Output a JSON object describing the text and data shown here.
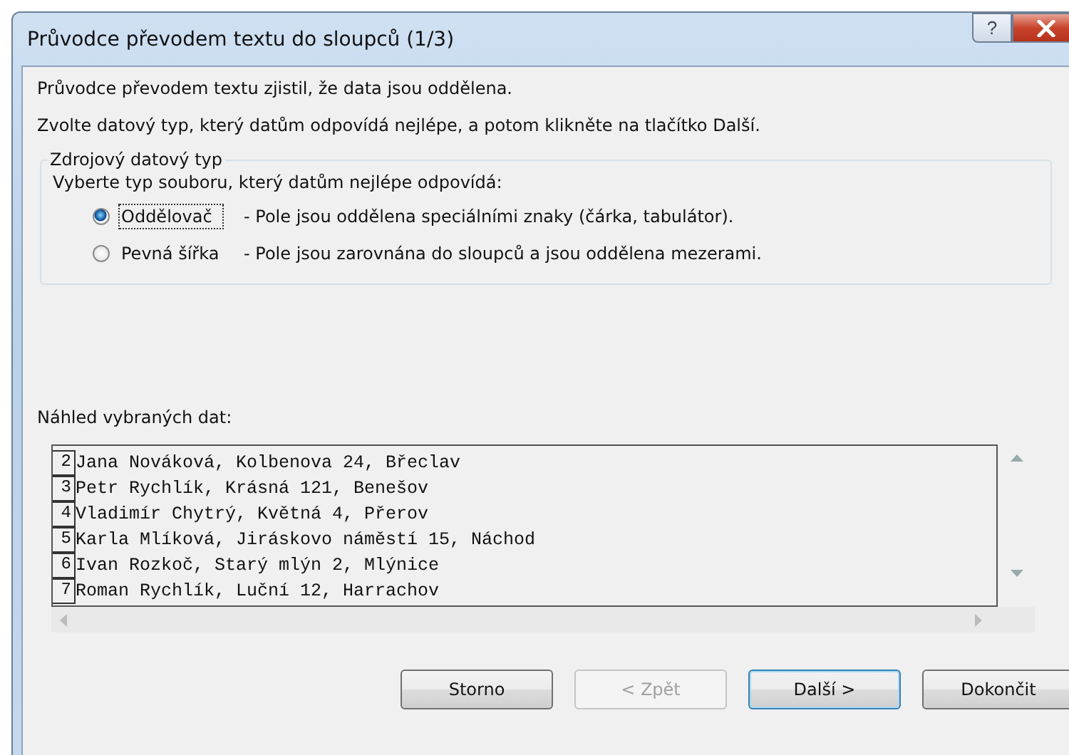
{
  "window": {
    "title": "Průvodce převodem textu do sloupců (1/3)",
    "help_button": "?"
  },
  "intro": "Průvodce převodem textu zjistil, že data jsou oddělena.",
  "instruction": "Zvolte datový typ, který datům odpovídá nejlépe, a potom klikněte na tlačítko Další.",
  "group": {
    "title": "Zdrojový datový typ",
    "prompt": "Vyberte typ souboru, který datům nejlépe odpovídá:",
    "options": [
      {
        "label": "Oddělovač",
        "description": "- Pole jsou oddělena speciálními znaky (čárka, tabulátor).",
        "selected": true
      },
      {
        "label": "Pevná šířka",
        "description": "- Pole jsou zarovnána do sloupců a jsou oddělena mezerami.",
        "selected": false
      }
    ]
  },
  "preview": {
    "label": "Náhled vybraných dat:",
    "rows": [
      {
        "number": "2",
        "text": "Jana Nováková, Kolbenova 24, Břeclav"
      },
      {
        "number": "3",
        "text": "Petr Rychlík, Krásná 121, Benešov"
      },
      {
        "number": "4",
        "text": "Vladimír Chytrý, Květná 4, Přerov"
      },
      {
        "number": "5",
        "text": "Karla Mlíková, Jiráskovo náměstí 15, Náchod"
      },
      {
        "number": "6",
        "text": "Ivan Rozkoč, Starý mlýn 2, Mlýnice"
      },
      {
        "number": "7",
        "text": "Roman Rychlík, Luční 12, Harrachov"
      }
    ]
  },
  "buttons": [
    {
      "label": "Storno",
      "disabled": false,
      "default": false
    },
    {
      "label": "< Zpět",
      "disabled": true,
      "default": false
    },
    {
      "label": "Další >",
      "disabled": false,
      "default": true
    },
    {
      "label": "Dokončit",
      "disabled": false,
      "default": false
    }
  ]
}
